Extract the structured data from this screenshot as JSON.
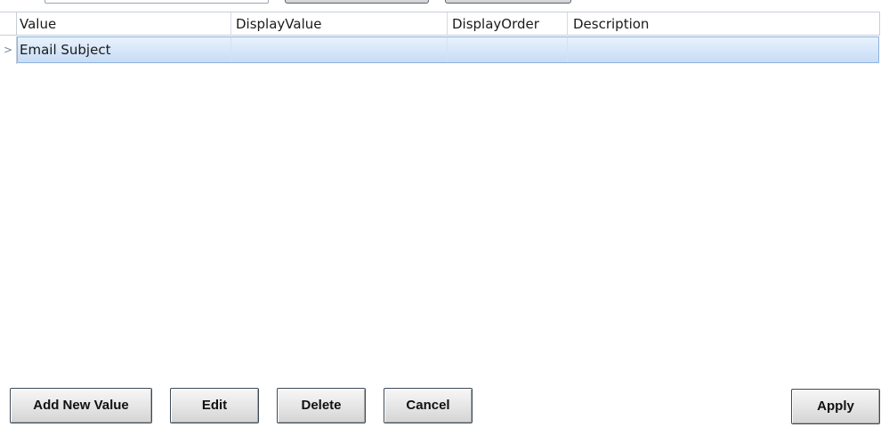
{
  "grid": {
    "columns": [
      "Value",
      "DisplayValue",
      "DisplayOrder",
      "Description"
    ],
    "rows": [
      {
        "indicator": ">",
        "value": "Email Subject",
        "display_value": "",
        "display_order": "",
        "description": ""
      }
    ]
  },
  "buttons": {
    "add_new_value": "Add New Value",
    "edit": "Edit",
    "delete": "Delete",
    "cancel": "Cancel",
    "apply": "Apply"
  }
}
